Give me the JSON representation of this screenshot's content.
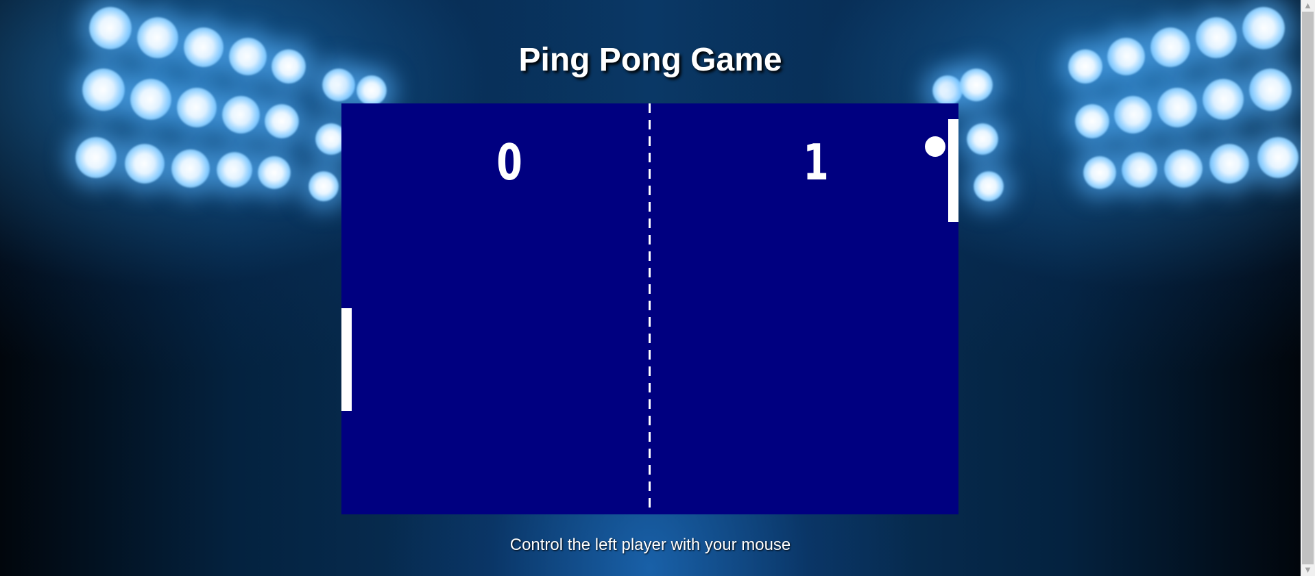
{
  "page": {
    "title": "Ping Pong Game",
    "instructions": "Control the left player with your mouse"
  },
  "game": {
    "scores": {
      "left": "0",
      "right": "1"
    },
    "colors": {
      "court": "#000080",
      "paddles": "#ffffff",
      "ball": "#ffffff",
      "net": "#ffffff"
    }
  },
  "icons": {
    "scroll_up": "scroll-up-arrow-icon",
    "scroll_down": "scroll-down-arrow-icon"
  }
}
